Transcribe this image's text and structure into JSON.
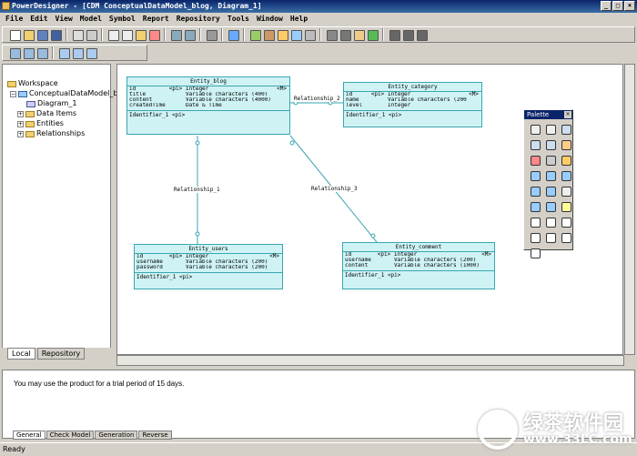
{
  "window": {
    "title": "PowerDesigner - [CDM ConceptualDataModel_blog, Diagram_1]",
    "min": "_",
    "max": "□",
    "close": "×"
  },
  "menu": [
    "File",
    "Edit",
    "View",
    "Model",
    "Symbol",
    "Report",
    "Repository",
    "Tools",
    "Window",
    "Help"
  ],
  "browser": {
    "tree": [
      {
        "label": "Workspace"
      },
      {
        "label": "ConceptualDataModel_b"
      },
      {
        "label": "Diagram_1"
      },
      {
        "label": "Data Items"
      },
      {
        "label": "Entities"
      },
      {
        "label": "Relationships"
      }
    ],
    "tabs": [
      "Local",
      "Repository"
    ]
  },
  "entities": {
    "blog": {
      "name": "Entity_blog",
      "attrs": [
        {
          "name": "id",
          "key": "<pi>",
          "type": "Integer",
          "m": "<M>"
        },
        {
          "name": "title",
          "key": "",
          "type": "Variable characters (400)",
          "m": ""
        },
        {
          "name": "content",
          "key": "",
          "type": "Variable characters (4000)",
          "m": ""
        },
        {
          "name": "createdTime",
          "key": "",
          "type": "Date & Time",
          "m": ""
        }
      ],
      "identifier": "Identifier_1  <pi>"
    },
    "category": {
      "name": "Entity_category",
      "attrs": [
        {
          "name": "id",
          "key": "<pi>",
          "type": "Integer",
          "m": "<M>"
        },
        {
          "name": "name",
          "key": "",
          "type": "Variable characters (200)",
          "m": ""
        },
        {
          "name": "level",
          "key": "",
          "type": "Integer",
          "m": ""
        }
      ],
      "identifier": "Identifier_1  <pi>"
    },
    "users": {
      "name": "Entity_users",
      "attrs": [
        {
          "name": "id",
          "key": "<pi>",
          "type": "Integer",
          "m": "<M>"
        },
        {
          "name": "username",
          "key": "",
          "type": "Variable characters (200)",
          "m": ""
        },
        {
          "name": "password",
          "key": "",
          "type": "Variable characters (200)",
          "m": ""
        }
      ],
      "identifier": "Identifier_1  <pi>"
    },
    "comment": {
      "name": "Entity_comment",
      "attrs": [
        {
          "name": "id",
          "key": "<pi>",
          "type": "Integer",
          "m": "<M>"
        },
        {
          "name": "username",
          "key": "",
          "type": "Variable characters (200)",
          "m": ""
        },
        {
          "name": "content",
          "key": "",
          "type": "Variable characters (1000)",
          "m": ""
        }
      ],
      "identifier": "Identifier_1  <pi>"
    }
  },
  "relationships": [
    "Relationship_1",
    "Relationship_2",
    "Relationship_3"
  ],
  "palette": {
    "title": "Palette",
    "close": "×"
  },
  "output": {
    "message": "You may use the product for a trial period of 15 days.",
    "tabs": [
      "General",
      "Check Model",
      "Generation",
      "Reverse"
    ]
  },
  "status": "Ready",
  "watermark": {
    "brand": "绿茶软件园",
    "url": "www.33LC.com"
  },
  "colors": {
    "entity_fill": "#cff3f5",
    "entity_border": "#3aa6b0",
    "title_bar": "#0a246a"
  }
}
